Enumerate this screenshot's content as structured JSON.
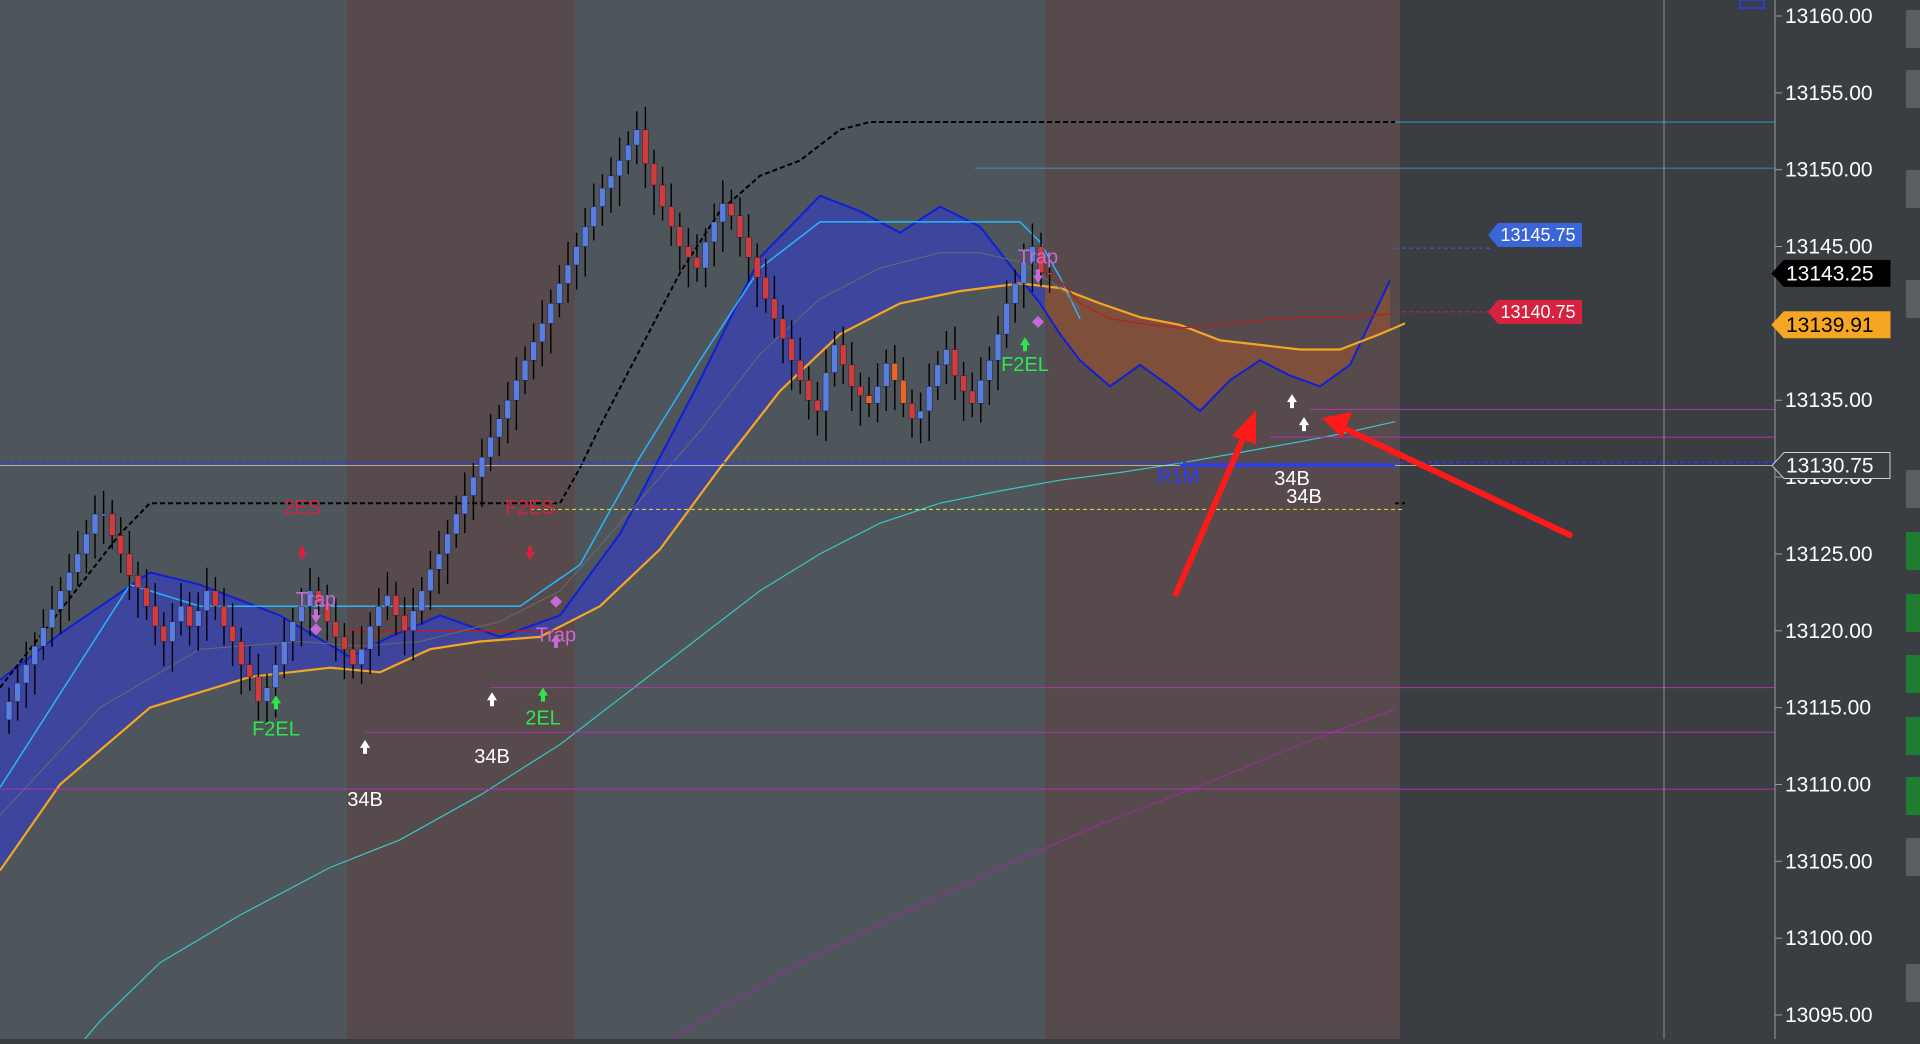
{
  "chart_data": {
    "type": "candlestick",
    "y_range": [
      13090,
      13162
    ],
    "y_ticks": [
      "13160.00",
      "13155.00",
      "13150.00",
      "13145.00",
      "13140.00",
      "13135.00",
      "13130.00",
      "13125.00",
      "13120.00",
      "13115.00",
      "13110.00",
      "13105.00",
      "13100.00",
      "13095.00"
    ],
    "price_labels": [
      {
        "id": "last",
        "value": 13143.25,
        "text": "13143.25",
        "color": "#000000",
        "text_color": "#ffffff"
      },
      {
        "id": "ema",
        "value": 13139.91,
        "text": "13139.91",
        "color": "#f5a623",
        "text_color": "#000000"
      },
      {
        "id": "level",
        "value": 13130.75,
        "text": "13130.75",
        "color": "#3a3d42",
        "text_color": "#ffffff"
      }
    ],
    "order_tags": [
      {
        "id": "target",
        "value": 13145.75,
        "text": "13145.75",
        "color": "#3a66d8"
      },
      {
        "id": "stop",
        "value": 13140.75,
        "text": "13140.75",
        "color": "#d7223f"
      }
    ],
    "session_bands": [
      {
        "x0": 0,
        "x1": 347,
        "color": "#4e555b"
      },
      {
        "x0": 347,
        "x1": 575,
        "color": "#564a4d"
      },
      {
        "x0": 575,
        "x1": 1045,
        "color": "#4e555b"
      },
      {
        "x0": 1045,
        "x1": 1400,
        "color": "#564a4d"
      }
    ],
    "annotations": [
      {
        "text": "2ES",
        "price": 13127.6,
        "x": 302,
        "color": "#d7223f"
      },
      {
        "text": "F2ES",
        "price": 13127.6,
        "x": 530,
        "color": "#d7223f"
      },
      {
        "text": "Trap",
        "price": 13121.6,
        "x": 316,
        "color": "#c76ad8"
      },
      {
        "text": "Trap",
        "price": 13119.3,
        "x": 556,
        "color": "#c76ad8"
      },
      {
        "text": "Trap",
        "price": 13143.9,
        "x": 1038,
        "color": "#c76ad8"
      },
      {
        "text": "F2EL",
        "price": 13113.2,
        "x": 276,
        "color": "#2ee84a"
      },
      {
        "text": "2EL",
        "price": 13113.9,
        "x": 543,
        "color": "#2ee84a"
      },
      {
        "text": "F2EL",
        "price": 13136.9,
        "x": 1025,
        "color": "#2ee84a"
      },
      {
        "text": "34B",
        "price": 13108.6,
        "x": 365,
        "color": "#ffffff"
      },
      {
        "text": "34B",
        "price": 13111.4,
        "x": 492,
        "color": "#ffffff"
      },
      {
        "text": "34B",
        "price": 13129.5,
        "x": 1292,
        "color": "#ffffff"
      },
      {
        "text": "34B",
        "price": 13128.3,
        "x": 1304,
        "color": "#ffffff"
      },
      {
        "text": "R1M",
        "price": 13129.6,
        "x": 1178,
        "color": "#2a3cff"
      }
    ],
    "candles": {
      "x_start": 6,
      "x_step": 8.6,
      "closes": [
        13115.4,
        13116.6,
        13117.8,
        13119.0,
        13120.2,
        13121.4,
        13122.6,
        13123.8,
        13125.0,
        13126.3,
        13127.6,
        13127.6,
        13126.2,
        13125.0,
        13123.6,
        13122.8,
        13121.6,
        13120.3,
        13119.3,
        13120.6,
        13121.6,
        13120.3,
        13121.3,
        13122.6,
        13121.6,
        13120.3,
        13119.3,
        13117.8,
        13117.0,
        13115.4,
        13116.3,
        13117.8,
        13119.3,
        13120.6,
        13121.6,
        13122.6,
        13121.8,
        13120.6,
        13119.6,
        13118.8,
        13117.8,
        13118.8,
        13120.3,
        13121.6,
        13122.3,
        13121.0,
        13120.0,
        13121.3,
        13122.6,
        13124.0,
        13125.0,
        13126.3,
        13127.6,
        13128.8,
        13130.0,
        13131.3,
        13132.6,
        13133.8,
        13135.0,
        13136.3,
        13137.6,
        13138.8,
        13140.0,
        13141.3,
        13142.6,
        13143.8,
        13145.0,
        13146.3,
        13147.6,
        13148.8,
        13149.6,
        13150.6,
        13151.6,
        13152.6,
        13150.4,
        13149.0,
        13147.6,
        13146.3,
        13145.0,
        13144.3,
        13143.6,
        13145.3,
        13146.6,
        13147.8,
        13147.0,
        13145.6,
        13144.3,
        13143.0,
        13141.6,
        13140.3,
        13139.0,
        13137.6,
        13136.3,
        13135.0,
        13134.3,
        13136.8,
        13138.6,
        13137.3,
        13135.9,
        13135.3,
        13134.8,
        13135.9,
        13137.4,
        13136.3,
        13134.8,
        13133.8,
        13134.3,
        13135.9,
        13137.3,
        13138.3,
        13136.6,
        13135.6,
        13134.8,
        13136.3,
        13137.6,
        13139.3,
        13141.3,
        13142.6,
        13144.0,
        13145.0,
        13143.3,
        13143.25
      ],
      "up_color": "#5a7de0",
      "down_color": "#d23b3b",
      "accent_color": "#e8662a"
    },
    "series": [
      {
        "id": "upper-channel",
        "color": "#0f1fd8",
        "width": 2,
        "x": [
          0,
          60,
          150,
          200,
          280,
          350,
          390,
          440,
          500,
          560,
          620,
          700,
          760,
          820,
          860,
          900,
          940,
          980,
          1010,
          1040,
          1060,
          1080,
          1110,
          1140,
          1170,
          1200,
          1230,
          1260,
          1290,
          1320,
          1350,
          1390
        ],
        "y": [
          13116.8,
          13119.8,
          13123.8,
          13123.0,
          13121.0,
          13118.3,
          13119.6,
          13121.0,
          13119.6,
          13121.0,
          13126.3,
          13136.3,
          13144.3,
          13148.3,
          13147.3,
          13145.9,
          13147.6,
          13146.3,
          13143.8,
          13141.3,
          13139.3,
          13137.6,
          13135.9,
          13137.3,
          13135.9,
          13134.3,
          13136.3,
          13137.6,
          13136.6,
          13135.9,
          13137.3,
          13142.8
        ]
      },
      {
        "id": "cyan-line",
        "color": "#29b6ff",
        "width": 1.5,
        "x": [
          0,
          130,
          200,
          300,
          345,
          400,
          520,
          580,
          640,
          700,
          760,
          820,
          860,
          1020,
          1040,
          1060,
          1080
        ],
        "y": [
          13109.8,
          13123.0,
          13121.6,
          13121.6,
          13121.6,
          13121.6,
          13121.6,
          13124.3,
          13131.3,
          13137.6,
          13143.6,
          13146.6,
          13146.6,
          13146.6,
          13145.3,
          13143.0,
          13140.3
        ]
      },
      {
        "id": "orange-ema",
        "color": "#f5a623",
        "width": 2.2,
        "x": [
          0,
          60,
          150,
          250,
          330,
          380,
          430,
          480,
          540,
          600,
          660,
          720,
          780,
          840,
          900,
          960,
          1020,
          1060,
          1100,
          1140,
          1180,
          1220,
          1260,
          1300,
          1340,
          1380,
          1405
        ],
        "y": [
          13104.4,
          13110.0,
          13115.0,
          13117.0,
          13117.6,
          13117.3,
          13118.8,
          13119.3,
          13119.6,
          13121.6,
          13125.3,
          13130.6,
          13135.6,
          13139.3,
          13141.3,
          13142.1,
          13142.6,
          13142.3,
          13141.3,
          13140.4,
          13139.9,
          13138.9,
          13138.6,
          13138.3,
          13138.3,
          13139.3,
          13140.0
        ]
      },
      {
        "id": "red-channel",
        "color": "#b02222",
        "width": 1.3,
        "x": [
          345,
          400,
          450,
          500,
          560,
          570
        ],
        "y": [
          13120.0,
          13120.0,
          13120.0,
          13120.0,
          13120.0,
          13120.0
        ]
      },
      {
        "id": "red-channel-2",
        "color": "#b02222",
        "width": 1.3,
        "x": [
          1040,
          1060,
          1080,
          1110,
          1140,
          1180,
          1220,
          1260,
          1300,
          1340,
          1390
        ],
        "y": [
          13143.8,
          13142.8,
          13141.3,
          13140.3,
          13140.0,
          13139.7,
          13139.9,
          13140.2,
          13140.4,
          13140.4,
          13140.6
        ]
      },
      {
        "id": "grey-mid",
        "color": "#6a6a70",
        "width": 1,
        "x": [
          0,
          100,
          200,
          300,
          360,
          420,
          500,
          560,
          620,
          700,
          760,
          820,
          880,
          940,
          980,
          1020,
          1060,
          1080
        ],
        "y": [
          13108.0,
          13115.0,
          13118.8,
          13119.3,
          13119.0,
          13119.3,
          13120.6,
          13122.6,
          13127.0,
          13133.0,
          13138.0,
          13141.6,
          13143.6,
          13144.6,
          13144.6,
          13144.0,
          13142.3,
          13140.9
        ]
      },
      {
        "id": "teal-ma",
        "color": "#36c9c6",
        "width": 1.2,
        "x": [
          40,
          100,
          160,
          240,
          330,
          400,
          480,
          560,
          640,
          700,
          760,
          820,
          880,
          940,
          1000,
          1060,
          1120,
          1180,
          1240,
          1300,
          1340,
          1395
        ],
        "y": [
          13090.0,
          13094.6,
          13098.4,
          13101.5,
          13104.6,
          13106.4,
          13109.3,
          13112.6,
          13116.6,
          13119.6,
          13122.6,
          13125.0,
          13127.0,
          13128.3,
          13129.1,
          13129.8,
          13130.3,
          13130.9,
          13131.6,
          13132.3,
          13132.8,
          13133.6
        ]
      },
      {
        "id": "purple-ma",
        "color": "#9a2d9a",
        "width": 1.2,
        "x": [
          590,
          700,
          800,
          900,
          1000,
          1100,
          1200,
          1300,
          1395
        ],
        "y": [
          13090.0,
          13094.6,
          13098.4,
          13101.5,
          13104.6,
          13107.4,
          13109.9,
          13112.6,
          13114.9
        ]
      },
      {
        "id": "black-trail",
        "color": "#000000",
        "width": 2,
        "dashed": true,
        "x": [
          0,
          30,
          60,
          90,
          120,
          150,
          160,
          165,
          540,
          560,
          580,
          600,
          640,
          680,
          720,
          760,
          800,
          840,
          870,
          872,
          1395
        ],
        "y": [
          13116.3,
          13118.8,
          13121.3,
          13123.8,
          13126.3,
          13128.3,
          13128.3,
          13128.3,
          13128.3,
          13128.3,
          13130.6,
          13133.3,
          13138.3,
          13143.3,
          13147.3,
          13149.6,
          13150.6,
          13152.6,
          13153.1,
          13153.1,
          13153.1
        ]
      }
    ],
    "h_levels": [
      {
        "price": 13153.1,
        "x0": 1395,
        "x1": 1775,
        "color": "#3aa7d8",
        "dash": false,
        "width": 0.8
      },
      {
        "price": 13150.1,
        "x0": 975,
        "x1": 1775,
        "color": "#3aa7d8",
        "dash": false,
        "width": 0.8
      },
      {
        "price": 13144.9,
        "x0": 1395,
        "x1": 1490,
        "color": "#3a66d8",
        "dash": true,
        "width": 1
      },
      {
        "price": 13140.75,
        "x0": 1395,
        "x1": 1490,
        "color": "#d7223f",
        "dash": true,
        "width": 1
      },
      {
        "price": 13134.4,
        "x0": 1310,
        "x1": 1775,
        "color": "#b035b0",
        "dash": false,
        "width": 1
      },
      {
        "price": 13132.6,
        "x0": 1270,
        "x1": 1775,
        "color": "#b035b0",
        "dash": false,
        "width": 1
      },
      {
        "price": 13130.95,
        "x0": 0,
        "x1": 1775,
        "color": "#2a3cff",
        "dash": true,
        "width": 1.5
      },
      {
        "price": 13130.75,
        "x0": 0,
        "x1": 1775,
        "color": "#e8e8e8",
        "dash": false,
        "width": 0.6
      },
      {
        "price": 13130.75,
        "x0": 1180,
        "x1": 1395,
        "color": "#2a3cff",
        "dash": false,
        "width": 2.5
      },
      {
        "price": 13128.3,
        "x0": 1395,
        "x1": 1405,
        "color": "#000000",
        "dash": true,
        "width": 2
      },
      {
        "price": 13127.9,
        "x0": 530,
        "x1": 1405,
        "color": "#e6e62e",
        "dash": true,
        "width": 1
      },
      {
        "price": 13116.3,
        "x0": 490,
        "x1": 1775,
        "color": "#b035b0",
        "dash": false,
        "width": 1
      },
      {
        "price": 13113.4,
        "x0": 365,
        "x1": 1775,
        "color": "#b035b0",
        "dash": false,
        "width": 1
      },
      {
        "price": 13109.7,
        "x0": 0,
        "x1": 1775,
        "color": "#b035b0",
        "dash": false,
        "width": 1
      }
    ]
  }
}
